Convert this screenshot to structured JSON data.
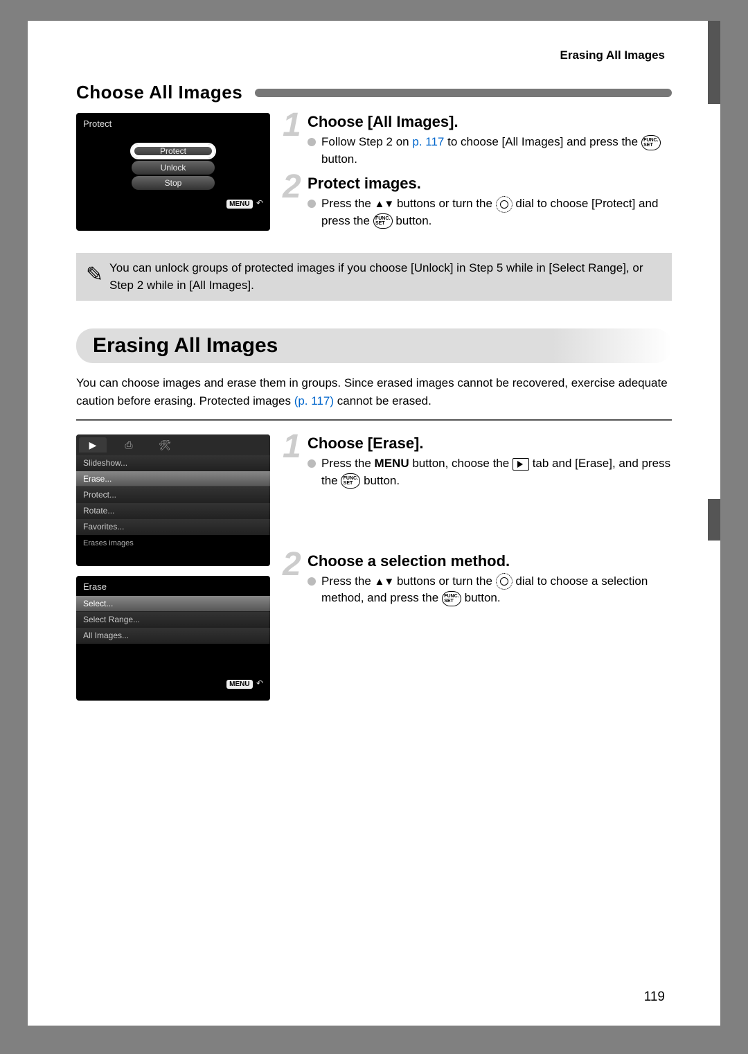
{
  "running_head": "Erasing All Images",
  "section1": {
    "title": "Choose All Images",
    "screen": {
      "title": "Protect",
      "options": [
        "Protect",
        "Unlock",
        "Stop"
      ],
      "menu_label": "MENU"
    },
    "step1": {
      "num": "1",
      "head": "Choose [All Images].",
      "bullet_a": "Follow Step 2 on ",
      "bullet_link": "p. 117",
      "bullet_b": " to choose [All Images] and press the ",
      "funcset": "FUNC. SET",
      "bullet_c": " button."
    },
    "step2": {
      "num": "2",
      "head": "Protect images.",
      "bullet_a": "Press the ",
      "arrows": "▲▼",
      "bullet_b": " buttons or turn the ",
      "bullet_c": " dial to choose [Protect] and press the ",
      "bullet_d": " button."
    }
  },
  "note": {
    "text": "You can unlock groups of protected images if you choose [Unlock] in Step 5 while in [Select Range], or Step 2 while in [All Images]."
  },
  "section2": {
    "heading": "Erasing All Images",
    "intro_a": "You can choose images and erase them in groups. Since erased images cannot be recovered, exercise adequate caution before erasing. Protected images ",
    "intro_link": "(p. 117)",
    "intro_b": " cannot be erased.",
    "screen1": {
      "tabs": [
        "▶",
        "⎙",
        "🛠"
      ],
      "items": [
        "Slideshow...",
        "Erase...",
        "Protect...",
        "Rotate...",
        "Favorites..."
      ],
      "footer": "Erases images"
    },
    "screen2": {
      "title": "Erase",
      "items": [
        "Select...",
        "Select Range...",
        "All Images..."
      ],
      "menu_label": "MENU"
    },
    "step1": {
      "num": "1",
      "head": "Choose [Erase].",
      "bullet_a": "Press the ",
      "menu": "MENU",
      "bullet_b": " button, choose the ",
      "bullet_c": " tab and [Erase], and press the ",
      "bullet_d": " button."
    },
    "step2": {
      "num": "2",
      "head": "Choose a selection method.",
      "bullet_a": "Press the ",
      "arrows": "▲▼",
      "bullet_b": " buttons or turn the ",
      "bullet_c": " dial to choose a selection method, and press the ",
      "bullet_d": " button."
    }
  },
  "page_number": "119"
}
